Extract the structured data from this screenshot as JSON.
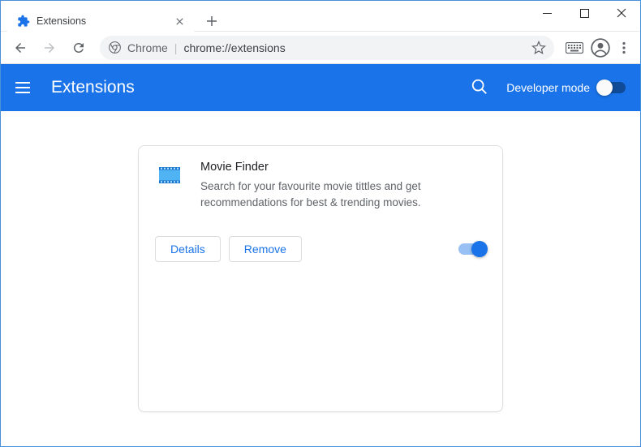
{
  "window": {
    "tab_title": "Extensions"
  },
  "omnibox": {
    "origin_label": "Chrome",
    "url": "chrome://extensions"
  },
  "header": {
    "title": "Extensions",
    "dev_mode_label": "Developer mode",
    "dev_mode_on": false
  },
  "card": {
    "name": "Movie Finder",
    "description": "Search for your favourite movie tittles and get recommendations for best & trending movies.",
    "details_label": "Details",
    "remove_label": "Remove",
    "enabled": true
  },
  "colors": {
    "primary": "#1a73e8"
  }
}
